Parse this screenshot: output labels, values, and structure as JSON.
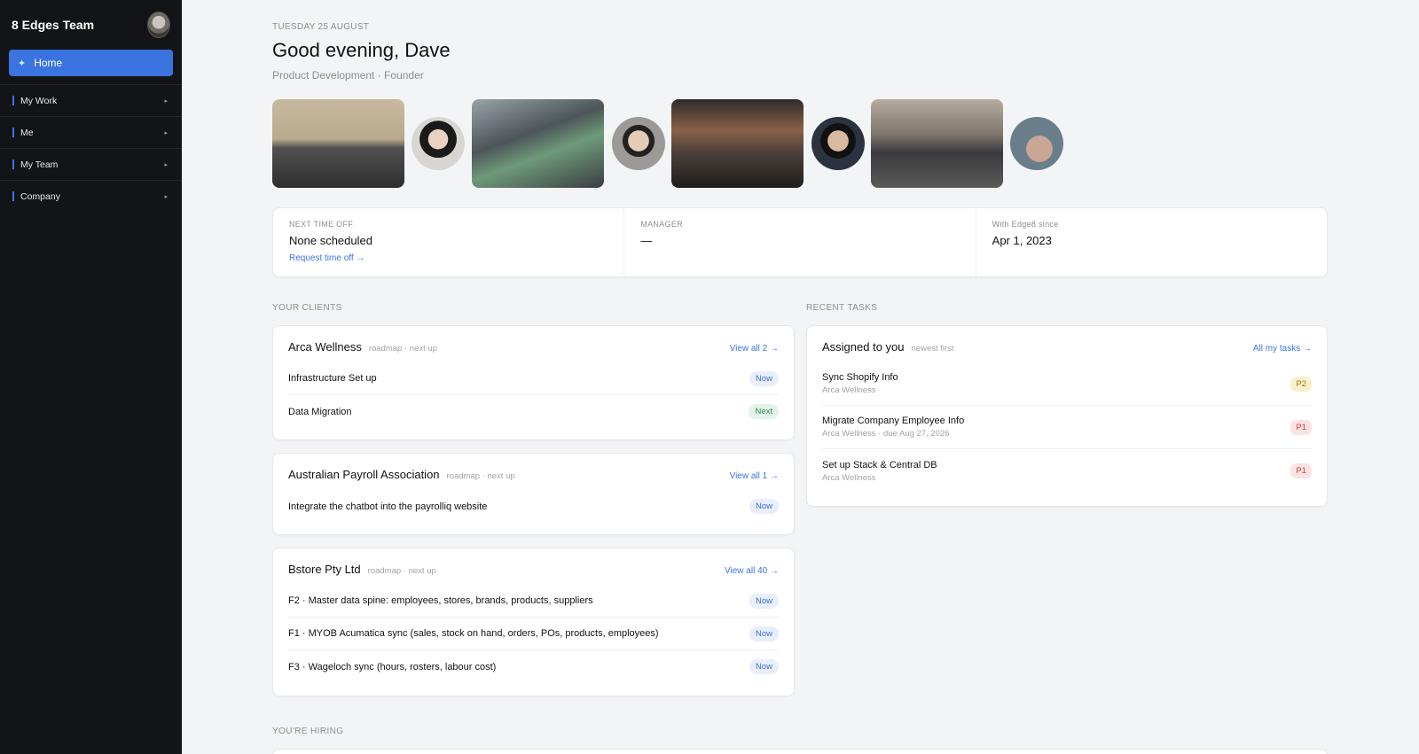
{
  "sidebar": {
    "team_name": "8 Edges Team",
    "home_label": "Home",
    "items": [
      {
        "label": "My Work"
      },
      {
        "label": "Me"
      },
      {
        "label": "My Team"
      },
      {
        "label": "Company"
      }
    ]
  },
  "header": {
    "date": "TUESDAY 25 AUGUST",
    "greeting": "Good evening, Dave",
    "role": "Product Development · Founder"
  },
  "stats": [
    {
      "label": "NEXT TIME OFF",
      "value": "None scheduled",
      "link": "Request time off →"
    },
    {
      "label": "MANAGER",
      "value": "—"
    },
    {
      "label": "With Edge8 since",
      "value": "Apr 1, 2023"
    }
  ],
  "clients_section": {
    "label": "YOUR CLIENTS",
    "clients": [
      {
        "name": "Arca Wellness",
        "sub": "roadmap · next up",
        "view": "View all 2 →",
        "items": [
          {
            "title": "Infrastructure Set up",
            "status": "Now"
          },
          {
            "title": "Data Migration",
            "status": "Next"
          }
        ]
      },
      {
        "name": "Australian Payroll Association",
        "sub": "roadmap · next up",
        "view": "View all 1 →",
        "items": [
          {
            "title": "Integrate the chatbot into the payrolliq website",
            "status": "Now"
          }
        ]
      },
      {
        "name": "Bstore Pty Ltd",
        "sub": "roadmap · next up",
        "view": "View all 40 →",
        "items": [
          {
            "title": "F2 · Master data spine: employees, stores, brands, products, suppliers",
            "status": "Now"
          },
          {
            "title": "F1 · MYOB Acumatica sync (sales, stock on hand, orders, POs, products, employees)",
            "status": "Now"
          },
          {
            "title": "F3 · Wageloch sync (hours, rosters, labour cost)",
            "status": "Now"
          }
        ]
      }
    ]
  },
  "tasks_section": {
    "label": "RECENT TASKS",
    "title": "Assigned to you",
    "sub": "newest first",
    "view": "All my tasks →",
    "tasks": [
      {
        "title": "Sync Shopify Info",
        "sub": "Arca Wellness",
        "priority": "P2"
      },
      {
        "title": "Migrate Company Employee Info",
        "sub": "Arca Wellness · due Aug 27, 2026",
        "priority": "P1"
      },
      {
        "title": "Set up Stack & Central DB",
        "sub": "Arca Wellness",
        "priority": "P1"
      }
    ]
  },
  "hiring_section": {
    "label": "YOU'RE HIRING"
  },
  "colors": {
    "accent": "#3b74e0",
    "sidebar_bg": "#131418",
    "page_bg": "#f3f4f6"
  }
}
